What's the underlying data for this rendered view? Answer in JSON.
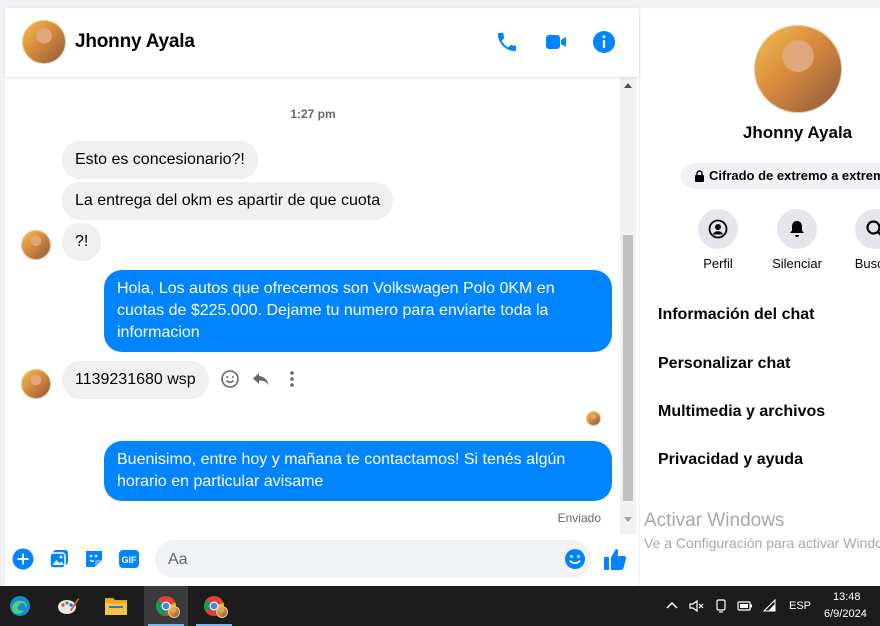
{
  "header": {
    "contact_name": "Jhonny Ayala"
  },
  "messages": {
    "time_separator": "1:27 pm",
    "incoming_1": "Esto es concesionario?!",
    "incoming_2": "La entrega del okm es apartir de que cuota",
    "incoming_3": "?!",
    "outgoing_1": "Hola, Los autos que ofrecemos son Volkswagen Polo 0KM en cuotas de $225.000. Dejame tu numero para enviarte toda la informacion",
    "incoming_4": "1139231680 wsp",
    "outgoing_2": "Buenisimo, entre hoy y mañana te contactamos! Si tenés algún horario en particular avisame",
    "sent_status": "Enviado"
  },
  "composer": {
    "placeholder": "Aa"
  },
  "info_panel": {
    "contact_name": "Jhonny Ayala",
    "encryption": "Cifrado de extremo a extremo",
    "actions": [
      {
        "label": "Perfil",
        "icon": "profile-icon"
      },
      {
        "label": "Silenciar",
        "icon": "bell-icon"
      },
      {
        "label": "Buscar",
        "icon": "search-icon"
      }
    ],
    "sections": [
      "Información del chat",
      "Personalizar chat",
      "Multimedia y archivos",
      "Privacidad y ayuda"
    ]
  },
  "watermark": {
    "line1": "Activar Windows",
    "line2": "Ve a Configuración para activar Windows."
  },
  "taskbar": {
    "language": "ESP",
    "time": "13:48",
    "date": "6/9/2024"
  },
  "colors": {
    "accent": "#0084ff",
    "incoming_bubble": "#f0f0f0",
    "taskbar": "#1c1c1c"
  }
}
